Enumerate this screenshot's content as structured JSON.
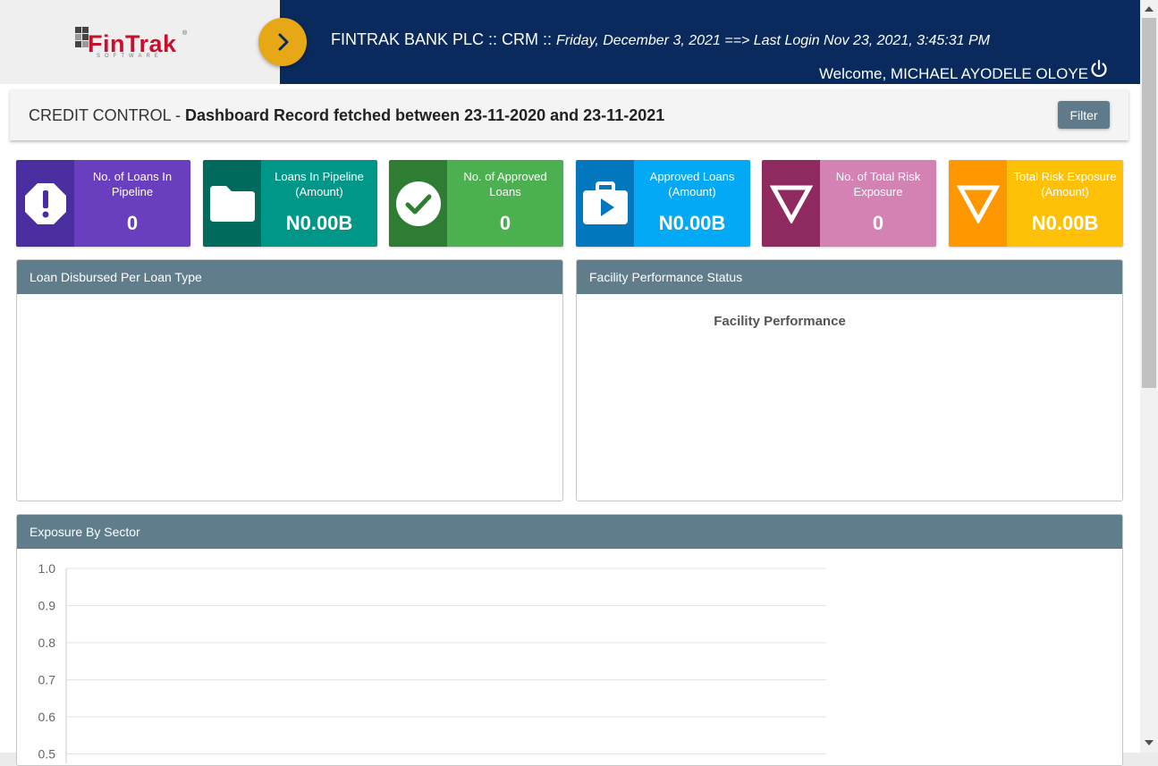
{
  "header": {
    "logo_text": "FinTrak",
    "logo_sub": "SOFTWARE",
    "logo_reg": "®",
    "bank_crm": "FINTRAK BANK PLC :: CRM :: ",
    "date_login": "Friday, December 3, 2021 ==> Last Login Nov 23, 2021, 3:45:31 PM",
    "welcome": "Welcome, MICHAEL AYODELE OLOYE"
  },
  "page": {
    "module": "CREDIT CONTROL",
    "separator": " - ",
    "record_text": "Dashboard Record fetched between 23-11-2020 and 23-11-2021",
    "filter_label": "Filter"
  },
  "stats": [
    {
      "label": "No. of Loans In Pipeline",
      "value": "0",
      "icon": "alert-octagon-icon",
      "dark": "#4a2d9e",
      "light": "#6a3fbf"
    },
    {
      "label": "Loans In Pipeline (Amount)",
      "value": "N0.00B",
      "icon": "folder-icon",
      "dark": "#006b5d",
      "light": "#009688"
    },
    {
      "label": "No. of Approved Loans",
      "value": "0",
      "icon": "check-circle-icon",
      "dark": "#2e7d32",
      "light": "#4caf50"
    },
    {
      "label": "Approved Loans (Amount)",
      "value": "N0.00B",
      "icon": "briefcase-play-icon",
      "dark": "#0277bd",
      "light": "#03a9f4"
    },
    {
      "label": "No. of Total Risk Exposure",
      "value": "0",
      "icon": "triangle-down-icon",
      "dark": "#8e2a5f",
      "light": "#d482b4"
    },
    {
      "label": "Total Risk Exposure (Amount)",
      "value": "N0.00B",
      "icon": "triangle-down-icon",
      "dark": "#ff9800",
      "light": "#ffc107"
    }
  ],
  "panels": {
    "loan_disbursed_title": "Loan Disbursed Per Loan Type",
    "facility_status_title": "Facility Performance Status",
    "facility_chart_title": "Facility Performance",
    "exposure_title": "Exposure By Sector"
  },
  "chart_data": {
    "type": "bar",
    "title": "",
    "categories": [],
    "values": [],
    "ylim": [
      0,
      1.0
    ],
    "yticks": [
      "1.0",
      "0.9",
      "0.8",
      "0.7",
      "0.6",
      "0.5"
    ],
    "grid": true
  }
}
